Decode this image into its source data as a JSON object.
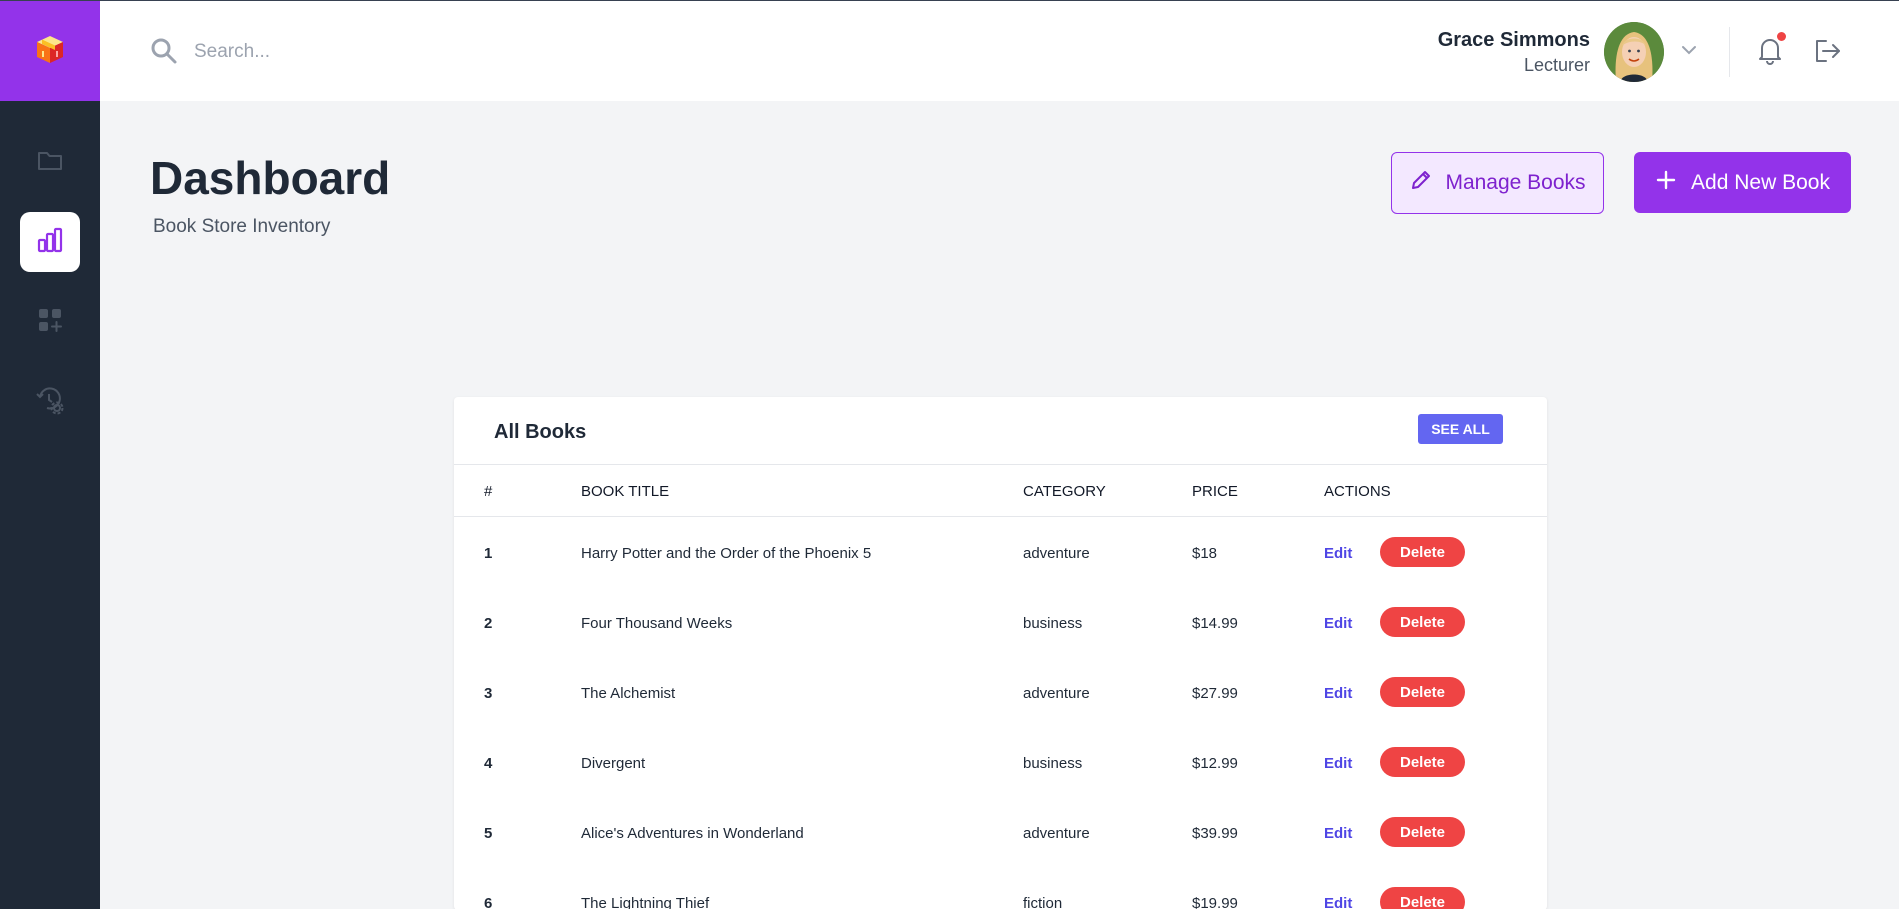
{
  "colors": {
    "brand": "#9333ea",
    "sidebar_bg": "#1f2937",
    "see_all": "#6366f1",
    "delete": "#ef4444",
    "notification_dot": "#ef4444"
  },
  "sidebar": {
    "logo_icon": "gift-box-logo-icon",
    "items": [
      {
        "icon": "folder-icon",
        "active": false
      },
      {
        "icon": "bar-chart-icon",
        "active": true
      },
      {
        "icon": "apps-add-icon",
        "active": false
      },
      {
        "icon": "history-settings-icon",
        "active": false
      }
    ]
  },
  "header": {
    "search_placeholder": "Search...",
    "user_name": "Grace Simmons",
    "user_role": "Lecturer",
    "has_notification": true
  },
  "page": {
    "title": "Dashboard",
    "subtitle": "Book Store Inventory",
    "manage_label": "Manage Books",
    "add_label": "Add New Book"
  },
  "table": {
    "title": "All Books",
    "see_all_label": "SEE ALL",
    "columns": [
      "#",
      "BOOK TITLE",
      "CATEGORY",
      "PRICE",
      "ACTIONS"
    ],
    "edit_label": "Edit",
    "delete_label": "Delete",
    "rows": [
      {
        "num": "1",
        "title": "Harry Potter and the Order of the Phoenix 5",
        "category": "adventure",
        "price": "$18"
      },
      {
        "num": "2",
        "title": "Four Thousand Weeks",
        "category": "business",
        "price": "$14.99"
      },
      {
        "num": "3",
        "title": "The Alchemist",
        "category": "adventure",
        "price": "$27.99"
      },
      {
        "num": "4",
        "title": "Divergent",
        "category": "business",
        "price": "$12.99"
      },
      {
        "num": "5",
        "title": "Alice's Adventures in Wonderland",
        "category": "adventure",
        "price": "$39.99"
      },
      {
        "num": "6",
        "title": "The Lightning Thief",
        "category": "fiction",
        "price": "$19.99"
      }
    ]
  }
}
